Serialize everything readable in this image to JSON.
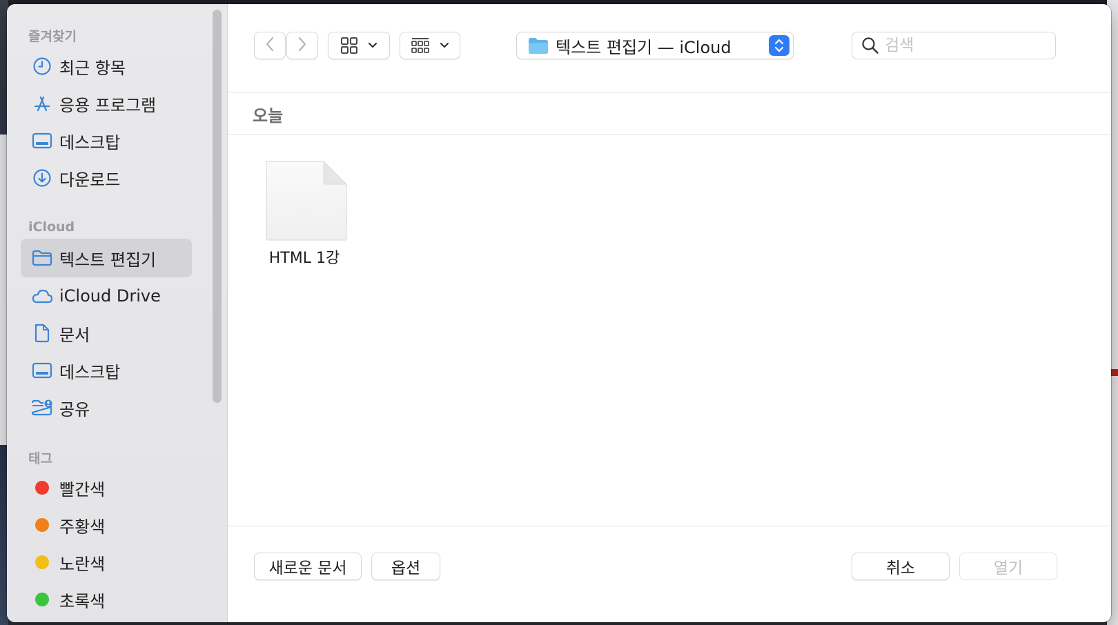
{
  "sidebar": {
    "favorites_title": "즐겨찾기",
    "favorites": [
      {
        "label": "최근 항목",
        "icon": "clock-icon"
      },
      {
        "label": "응용 프로그램",
        "icon": "apps-icon"
      },
      {
        "label": "데스크탑",
        "icon": "desktop-icon"
      },
      {
        "label": "다운로드",
        "icon": "download-icon"
      }
    ],
    "icloud_title": "iCloud",
    "icloud": [
      {
        "label": "텍스트 편집기",
        "icon": "folder-icon",
        "selected": true
      },
      {
        "label": "iCloud Drive",
        "icon": "cloud-icon"
      },
      {
        "label": "문서",
        "icon": "document-icon"
      },
      {
        "label": "데스크탑",
        "icon": "desktop-icon"
      },
      {
        "label": "공유",
        "icon": "shared-folder-icon"
      }
    ],
    "tags_title": "태그",
    "tags": [
      {
        "label": "빨간색",
        "color": "#f03a2e"
      },
      {
        "label": "주황색",
        "color": "#f08018"
      },
      {
        "label": "노란색",
        "color": "#f2be18"
      },
      {
        "label": "초록색",
        "color": "#3cc43f"
      }
    ]
  },
  "toolbar": {
    "location": "텍스트 편집기 — iCloud",
    "search_placeholder": "검색"
  },
  "content": {
    "group_title": "오늘",
    "files": [
      {
        "name": "HTML 1강",
        "icon": "document-icon"
      }
    ]
  },
  "footer": {
    "new_document": "새로운 문서",
    "options": "옵션",
    "cancel": "취소",
    "open": "열기"
  },
  "colors": {
    "accent": "#2f7cf6",
    "sidebar_icon": "#3a86d6"
  }
}
